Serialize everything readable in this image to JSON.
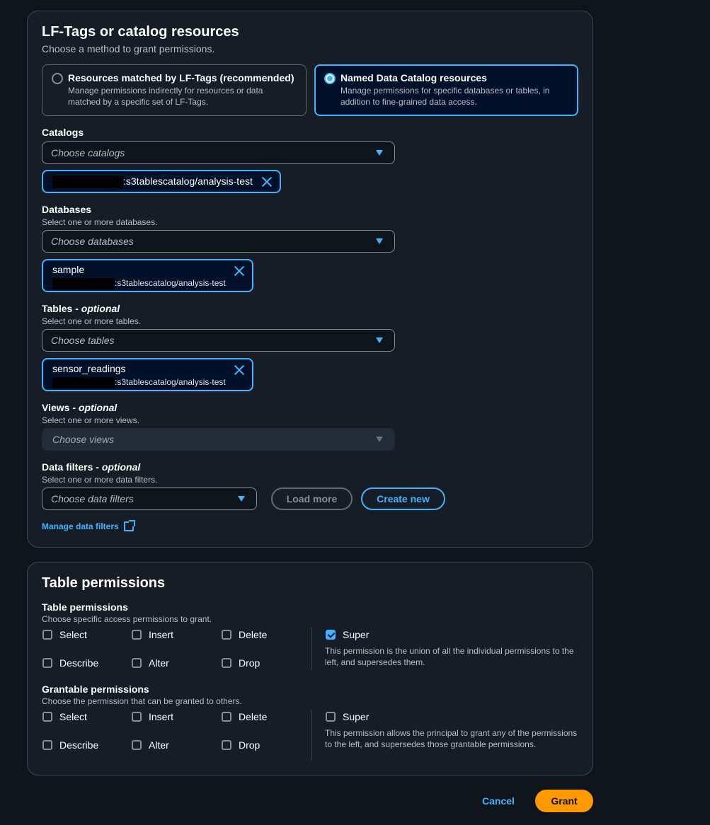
{
  "resources": {
    "title": "LF-Tags or catalog resources",
    "description": "Choose a method to grant permissions.",
    "tiles": [
      {
        "title": "Resources matched by LF-Tags (recommended)",
        "desc": "Manage permissions indirectly for resources or data matched by a specific set of LF-Tags.",
        "selected": false
      },
      {
        "title": "Named Data Catalog resources",
        "desc": "Manage permissions for specific databases or tables, in addition to fine-grained data access.",
        "selected": true
      }
    ],
    "catalogs": {
      "label": "Catalogs",
      "placeholder": "Choose catalogs",
      "token": ":s3tablescatalog/analysis-test"
    },
    "databases": {
      "label": "Databases",
      "description": "Select one or more databases.",
      "placeholder": "Choose databases",
      "token_label": "sample",
      "token_sub": ":s3tablescatalog/analysis-test"
    },
    "tables": {
      "label": "Tables",
      "optional": "optional",
      "description": "Select one or more tables.",
      "placeholder": "Choose tables",
      "token_label": "sensor_readings",
      "token_sub": ":s3tablescatalog/analysis-test"
    },
    "views": {
      "label": "Views",
      "optional": "optional",
      "description": "Select one or more views.",
      "placeholder": "Choose views"
    },
    "data_filters": {
      "label": "Data filters",
      "optional": "optional",
      "description": "Select one or more data filters.",
      "placeholder": "Choose data filters",
      "load_more": "Load more",
      "create_new": "Create new",
      "manage_link": "Manage data filters"
    }
  },
  "permissions": {
    "title": "Table permissions",
    "table": {
      "label": "Table permissions",
      "description": "Choose specific access permissions to grant.",
      "options": [
        "Select",
        "Insert",
        "Delete",
        "Describe",
        "Alter",
        "Drop"
      ],
      "super_label": "Super",
      "super_checked": true,
      "super_desc": "This permission is the union of all the individual permissions to the left, and supersedes them."
    },
    "grantable": {
      "label": "Grantable permissions",
      "description": "Choose the permission that can be granted to others.",
      "options": [
        "Select",
        "Insert",
        "Delete",
        "Describe",
        "Alter",
        "Drop"
      ],
      "super_label": "Super",
      "super_checked": false,
      "super_desc": "This permission allows the principal to grant any of the permissions to the left, and supersedes those grantable permissions."
    }
  },
  "footer": {
    "cancel": "Cancel",
    "grant": "Grant"
  },
  "colors": {
    "accent": "#42b4ff",
    "primary": "#ff9900",
    "background": "#0f141a",
    "panel": "#161d26"
  }
}
